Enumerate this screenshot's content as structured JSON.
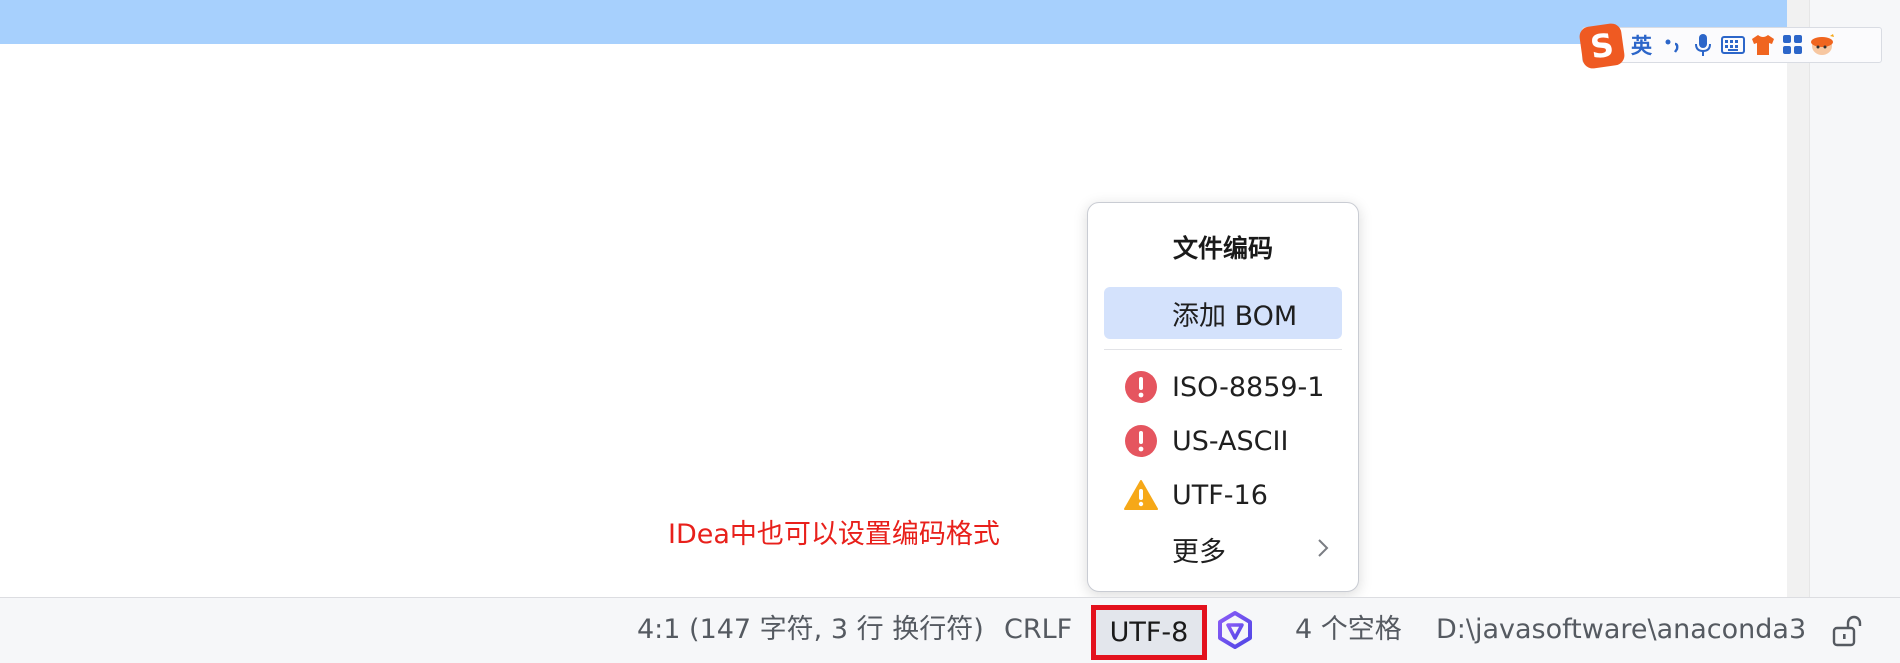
{
  "ime": {
    "logo": "S",
    "lang": "英",
    "icons": [
      "punctuation-icon",
      "microphone-icon",
      "keyboard-icon",
      "skin-icon",
      "toolbox-icon",
      "mascot-icon"
    ]
  },
  "popup": {
    "title": "文件编码",
    "add_bom": "添加 BOM",
    "items": [
      {
        "label": "ISO-8859-1",
        "icon": "error-icon",
        "color": "#e5555f"
      },
      {
        "label": "US-ASCII",
        "icon": "error-icon",
        "color": "#e5555f"
      },
      {
        "label": "UTF-16",
        "icon": "warning-icon",
        "color": "#f6a818"
      }
    ],
    "more": "更多"
  },
  "annotation": "IDea中也可以设置编码格式",
  "statusbar": {
    "position": "4:1 (147 字符, 3 行 换行符)",
    "line_ending": "CRLF",
    "encoding": "UTF-8",
    "indent": "4 个空格",
    "path": "D:\\javasoftware\\anaconda3"
  },
  "colors": {
    "topbar": "#a7d0fd",
    "selected_row": "#d4e2fc",
    "highlight_border": "#e3111d",
    "annotation": "#e8201b"
  }
}
